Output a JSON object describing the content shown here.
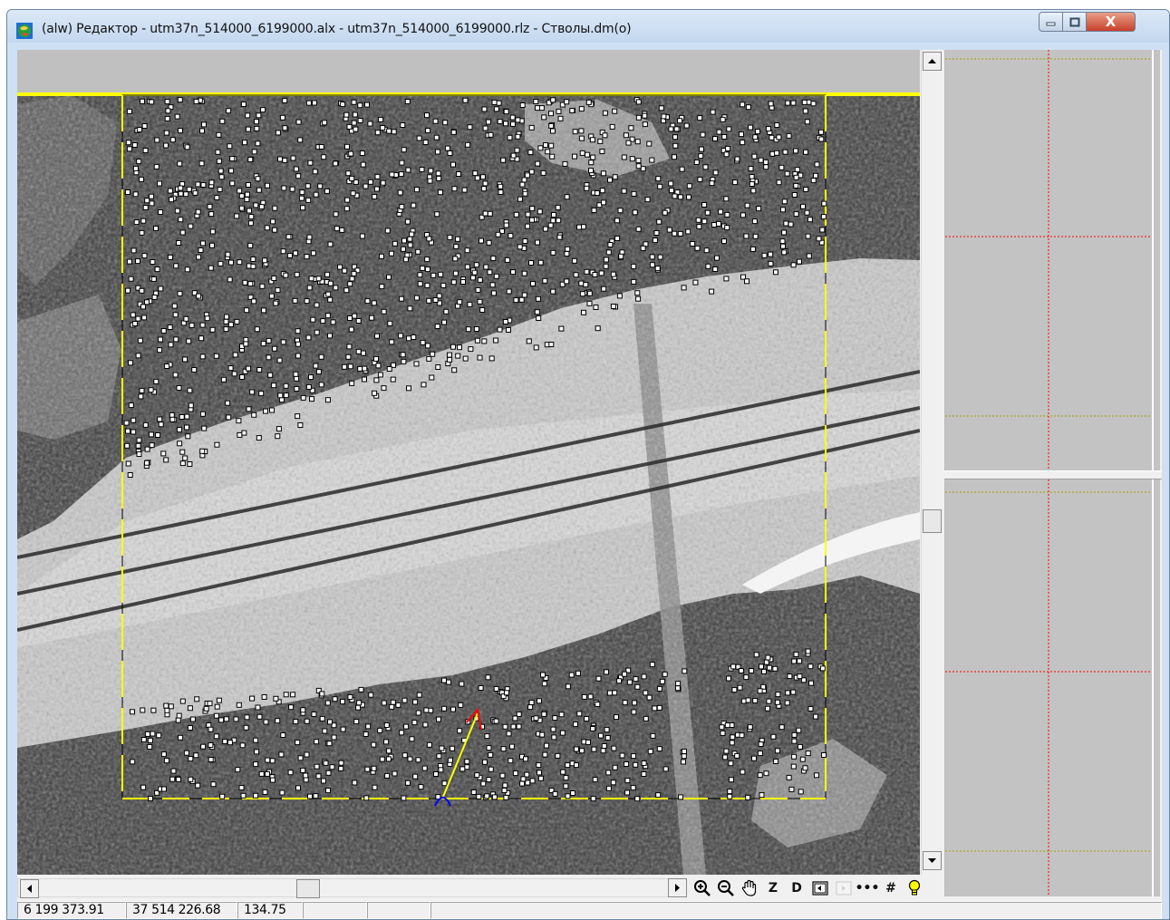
{
  "window": {
    "title": "(alw) Редактор - utm37n_514000_6199000.alx - utm37n_514000_6199000.rlz - Стволы.dm(o)",
    "app_icon": "globe-icon",
    "controls": {
      "minimize_icon": "minimize-icon",
      "maximize_icon": "maximize-icon",
      "close_label": "X"
    }
  },
  "map": {
    "background_colors": {
      "forest": "#3a3a3a",
      "clearing": "#cfcfcf",
      "empty": "#c0c0c0"
    },
    "boundary_color": "#ffff00",
    "frame_color": "#000000",
    "tree_marker_color": "#ffffff",
    "vector": {
      "start_color": "#0000ff",
      "line_color": "#ffff00",
      "end_color": "#ff0000"
    }
  },
  "toolbar": {
    "zoom_in_icon": "zoom-in-icon",
    "zoom_out_icon": "zoom-out-icon",
    "pan_icon": "hand-pan-icon",
    "z_label": "Z",
    "d_label": "D",
    "back_icon": "panel-back-icon",
    "forward_icon": "panel-forward-icon",
    "dash_label": "•••",
    "grid_label": "#",
    "light_icon": "lightbulb-icon"
  },
  "profile_panels": {
    "grid_color_red": "#ff0000",
    "grid_color_olive": "#a0a000",
    "background": "#c3c3c3"
  },
  "status": {
    "northing": "6 199 373.91",
    "easting": "37 514 226.68",
    "elevation": "134.75",
    "cell4": "",
    "cell5": ""
  }
}
